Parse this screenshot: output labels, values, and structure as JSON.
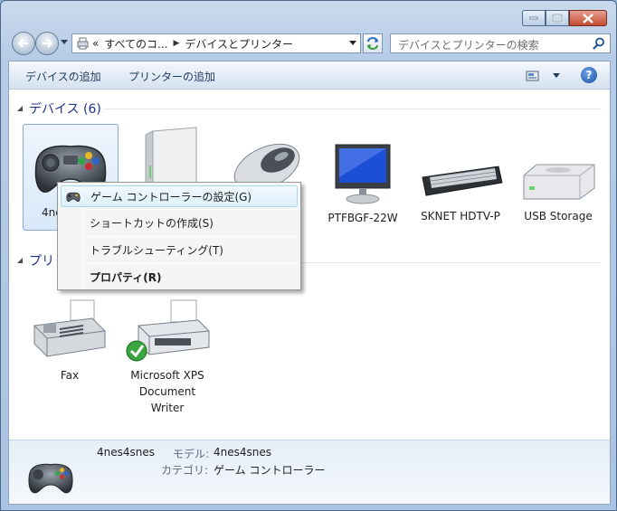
{
  "titlebar": {
    "buttons": {
      "minimize": "minimize-icon",
      "maximize": "maximize-icon",
      "close": "close-icon"
    }
  },
  "nav": {
    "address_prefix": "«",
    "crumbs": [
      "すべてのコ...",
      "デバイスとプリンター"
    ],
    "search_placeholder": "デバイスとプリンターの検索"
  },
  "toolbar": {
    "add_device": "デバイスの追加",
    "add_printer": "プリンターの追加"
  },
  "devices": {
    "header": "デバイス (6)",
    "items": [
      {
        "label": "4nes4snes",
        "icon": "gamepad-icon",
        "selected": true
      },
      {
        "label": "",
        "icon": "external-drive-icon"
      },
      {
        "label": "",
        "icon": "mouse-icon"
      },
      {
        "label": "PTFBGF-22W",
        "icon": "monitor-icon"
      },
      {
        "label": "SKNET HDTV-P",
        "icon": "keyboard-icon"
      },
      {
        "label": "USB Storage",
        "icon": "usb-storage-icon"
      }
    ]
  },
  "printers": {
    "header": "プリ",
    "items": [
      {
        "label": "Fax",
        "icon": "fax-icon"
      },
      {
        "label": "Microsoft XPS Document Writer",
        "line1": "Microsoft XPS",
        "line2": "Document",
        "line3": "Writer",
        "icon": "printer-icon"
      }
    ]
  },
  "context_menu": {
    "items": [
      {
        "label": "ゲーム コントローラーの設定(G)",
        "highlighted": true
      },
      {
        "label": "ショートカットの作成(S)"
      },
      {
        "label": "トラブルシューティング(T)"
      },
      {
        "label": "プロパティ(R)",
        "bold": true
      }
    ]
  },
  "details": {
    "name": "4nes4snes",
    "model_label": "モデル:",
    "model_value": "4nes4snes",
    "category_label": "カテゴリ:",
    "category_value": "ゲーム コントローラー"
  }
}
